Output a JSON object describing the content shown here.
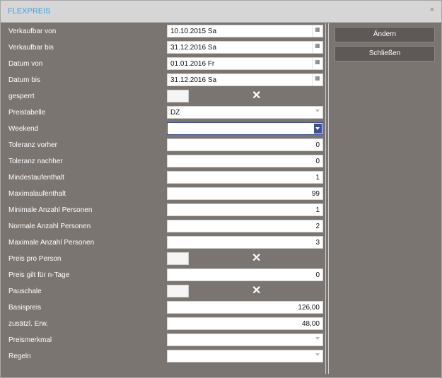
{
  "dialog": {
    "title": "FLEXPREIS",
    "close_glyph": "×"
  },
  "buttons": {
    "change": "Ändern",
    "close": "Schließen"
  },
  "fields": {
    "verkaufbar_von": {
      "label": "Verkaufbar von",
      "value": "10.10.2015 Sa"
    },
    "verkaufbar_bis": {
      "label": "Verkaufbar bis",
      "value": "31.12.2016 Sa"
    },
    "datum_von": {
      "label": "Datum von",
      "value": "01.01.2016 Fr"
    },
    "datum_bis": {
      "label": "Datum bis",
      "value": "31.12.2016 Sa"
    },
    "gesperrt": {
      "label": "gesperrt",
      "checked_glyph": "✕"
    },
    "preistabelle": {
      "label": "Preistabelle",
      "value": "DZ"
    },
    "weekend": {
      "label": "Weekend",
      "value": ""
    },
    "toleranz_vorher": {
      "label": "Toleranz vorher",
      "value": "0"
    },
    "toleranz_nachher": {
      "label": "Toleranz nachher",
      "value": "0"
    },
    "mindestaufenthalt": {
      "label": "Mindestaufenthalt",
      "value": "1"
    },
    "maximalaufenthalt": {
      "label": "Maximalaufenthalt",
      "value": "99"
    },
    "min_personen": {
      "label": "Minimale Anzahl Personen",
      "value": "1"
    },
    "normal_personen": {
      "label": "Normale Anzahl Personen",
      "value": "2"
    },
    "max_personen": {
      "label": "Maximale Anzahl Personen",
      "value": "3"
    },
    "preis_pro_person": {
      "label": "Preis pro Person",
      "checked_glyph": "✕"
    },
    "preis_n_tage": {
      "label": "Preis gilt für n-Tage",
      "value": "0"
    },
    "pauschale": {
      "label": "Pauschale",
      "checked_glyph": "✕"
    },
    "basispreis": {
      "label": "Basispreis",
      "value": "126,00"
    },
    "zusaetzl_erw": {
      "label": "zusätzl. Erw.",
      "value": "48,00"
    },
    "preismerkmal": {
      "label": "Preismerkmal",
      "value": ""
    },
    "regeln": {
      "label": "Regeln",
      "value": ""
    }
  },
  "icons": {
    "calendar": "calendar-icon",
    "dropdown": "chevron-down-icon",
    "close": "close-icon",
    "check": "x-mark-icon"
  },
  "colors": {
    "title": "#3aa3d8",
    "background": "#7a7571",
    "button": "#5e5956",
    "focus": "#3d4f8f"
  }
}
